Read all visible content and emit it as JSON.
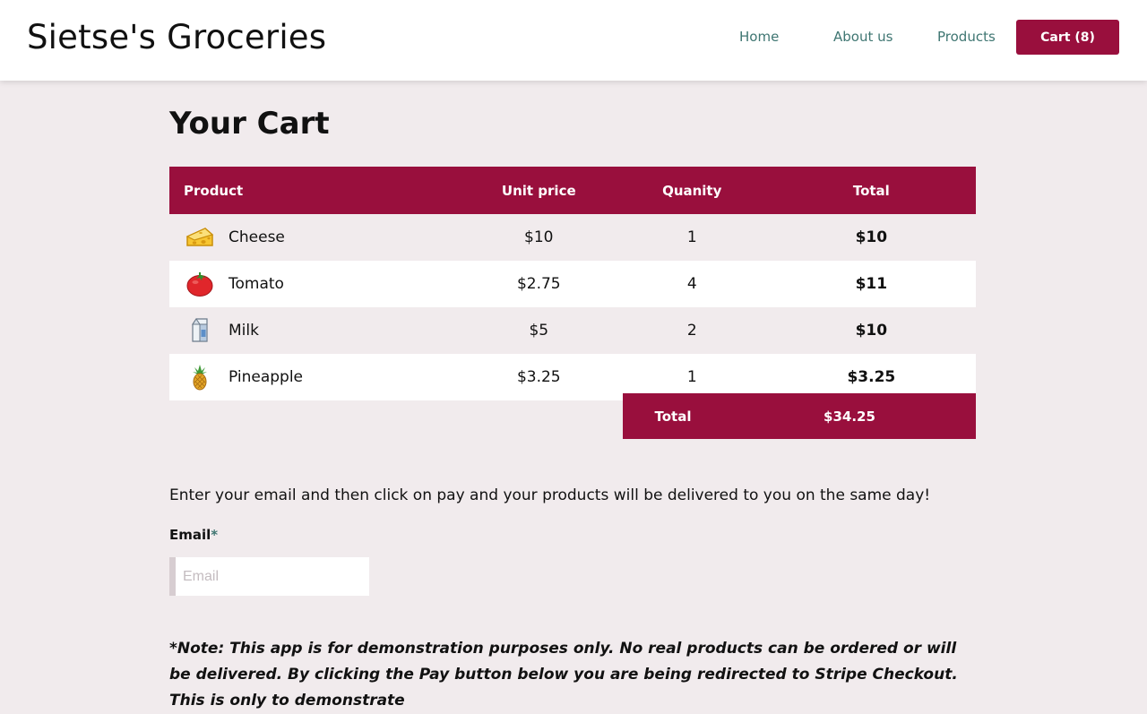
{
  "header": {
    "brand": "Sietse's Groceries",
    "nav": [
      "Home",
      "About us",
      "Products"
    ],
    "cart_label": "Cart (8)"
  },
  "page_title": "Your Cart",
  "table": {
    "headers": [
      "Product",
      "Unit price",
      "Quanity",
      "Total"
    ],
    "rows": [
      {
        "icon": "cheese-icon",
        "name": "Cheese",
        "unit_price": "$10",
        "quantity": "1",
        "total": "$10"
      },
      {
        "icon": "tomato-icon",
        "name": "Tomato",
        "unit_price": "$2.75",
        "quantity": "4",
        "total": "$11"
      },
      {
        "icon": "milk-icon",
        "name": "Milk",
        "unit_price": "$5",
        "quantity": "2",
        "total": "$10"
      },
      {
        "icon": "pineapple-icon",
        "name": "Pineapple",
        "unit_price": "$3.25",
        "quantity": "1",
        "total": "$3.25"
      }
    ],
    "grand_total_label": "Total",
    "grand_total_value": "$34.25"
  },
  "instructions": "Enter your email and then click on pay and your products will be delivered to you on the same day!",
  "email": {
    "label": "Email",
    "required_mark": "*",
    "placeholder": "Email",
    "value": ""
  },
  "note": "*Note: This app is for demonstration purposes only. No real products can be ordered or will be delivered. By clicking the Pay button below you are being redirected to Stripe Checkout. This is only to demonstrate",
  "colors": {
    "accent": "#990f3d",
    "nav_link": "#3f7672",
    "background": "#f1ebed"
  }
}
